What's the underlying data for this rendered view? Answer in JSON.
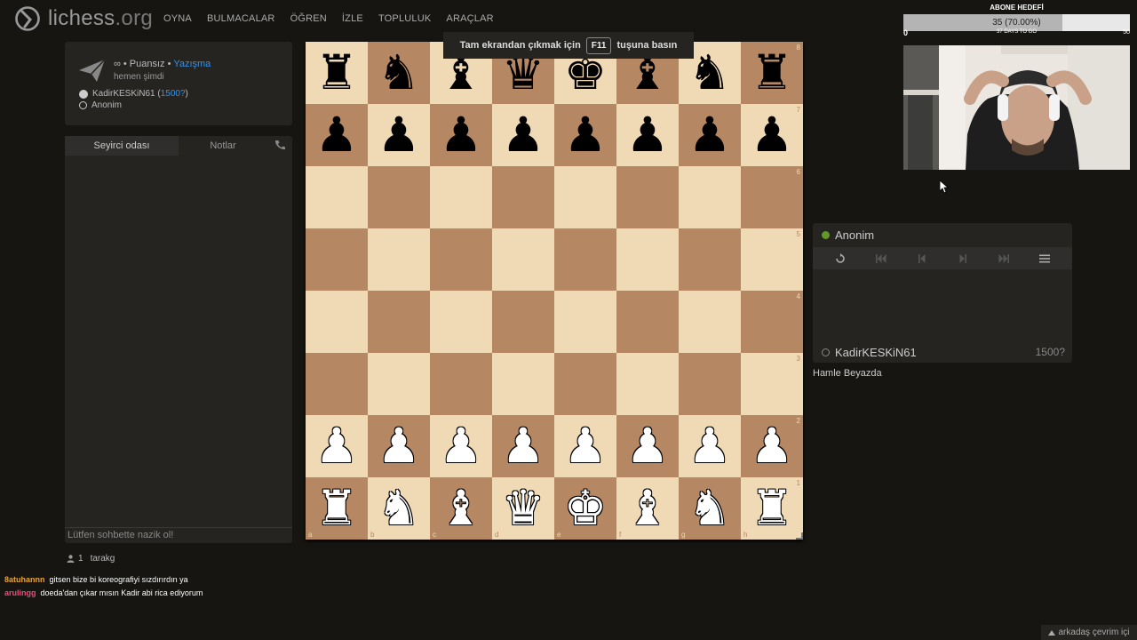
{
  "site": {
    "logo_text": "lichess",
    "logo_tld": ".org"
  },
  "nav": [
    "OYNA",
    "BULMACALAR",
    "ÖĞREN",
    "İZLE",
    "TOPLULUK",
    "ARAÇLAR"
  ],
  "game_info": {
    "mode_prefix": "∞ • Puansız • ",
    "mode_type": "Yazışma",
    "time": "hemen şimdi",
    "white_player": "KadirKESKiN61",
    "white_rating_open": " (",
    "white_rating": "1500?",
    "white_rating_close": ")",
    "black_player": "Anonim"
  },
  "chat": {
    "tab_spectator": "Seyirci odası",
    "tab_notes": "Notlar",
    "placeholder": "Lütfen sohbette nazik ol!"
  },
  "viewers": {
    "count": "1",
    "name": "tarakg"
  },
  "fullscreen_banner": {
    "before": "Tam ekrandan çıkmak için",
    "key": "F11",
    "after": "tuşuna basın"
  },
  "subscriber_goal": {
    "title": "ABONE HEDEFİ",
    "progress_text": "35 (70.00%)",
    "progress": 0.7,
    "min": "0",
    "max": "50",
    "days_left": "37 DAYS TO GO"
  },
  "right_panel": {
    "top_player": "Anonim",
    "bottom_player": "KadirKESKiN61",
    "bottom_rating": "1500?",
    "status": "Hamle Beyazda"
  },
  "twitch_chat": [
    {
      "user": "8atuhannn",
      "message": "gitsen bize bi koreografiyi sızdırırdın ya"
    },
    {
      "user": "arulingg",
      "message": "doeda'dan çıkar mısın Kadir abi rica ediyorum"
    }
  ],
  "friends_label": "arkadaş çevrim içi",
  "board": {
    "ranks": [
      "8",
      "7",
      "6",
      "5",
      "4",
      "3",
      "2",
      "1"
    ],
    "files": [
      "a",
      "b",
      "c",
      "d",
      "e",
      "f",
      "g",
      "h"
    ],
    "position": [
      [
        "r",
        "n",
        "b",
        "q",
        "k",
        "b",
        "n",
        "r"
      ],
      [
        "p",
        "p",
        "p",
        "p",
        "p",
        "p",
        "p",
        "p"
      ],
      [
        "",
        "",
        "",
        "",
        "",
        "",
        "",
        ""
      ],
      [
        "",
        "",
        "",
        "",
        "",
        "",
        "",
        ""
      ],
      [
        "",
        "",
        "",
        "",
        "",
        "",
        "",
        ""
      ],
      [
        "",
        "",
        "",
        "",
        "",
        "",
        "",
        ""
      ],
      [
        "P",
        "P",
        "P",
        "P",
        "P",
        "P",
        "P",
        "P"
      ],
      [
        "R",
        "N",
        "B",
        "Q",
        "K",
        "B",
        "N",
        "R"
      ]
    ]
  },
  "colors": {
    "light_square": "#f0d9b5",
    "dark_square": "#b58863",
    "accent_link": "#3692e7",
    "online_green": "#629924",
    "background": "#161512"
  }
}
